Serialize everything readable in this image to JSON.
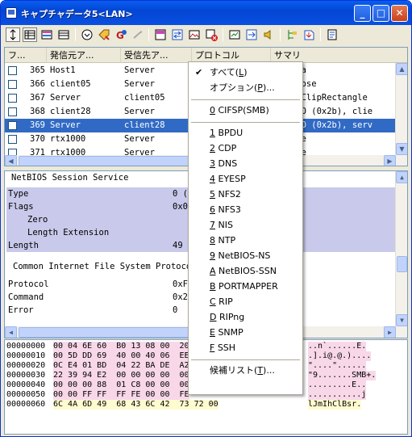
{
  "window": {
    "title": "キャプチャデータ5<LAN>"
  },
  "titlebar": {
    "min": "_",
    "max": "□",
    "close": "✕"
  },
  "toolbar": {
    "icons": [
      "expand-icon",
      "grid-view-icon",
      "color-view-icon",
      "table-view-icon",
      "filter-down-icon",
      "tag-icon",
      "refresh-g-icon",
      "cut-icon",
      "capture-icon",
      "swap-icon",
      "image-icon",
      "delete-icon",
      "export-icon",
      "import-icon",
      "sound-icon",
      "tree-icon",
      "download-icon",
      "notes-icon"
    ]
  },
  "list": {
    "headers": [
      "フ...",
      "発信元ア...",
      "受信先ア...",
      "プロトコル",
      "サマリ"
    ],
    "rows": [
      {
        "no": "365",
        "src": "Host1",
        "dst": "Server",
        "summary": "n Data",
        "selected": false
      },
      {
        "no": "366",
        "src": "client05",
        "dst": "Server",
        "summary": "n Expose",
        "selected": false
      },
      {
        "no": "367",
        "src": "Server",
        "dst": "client05",
        "summary": ": SetClipRectangle",
        "selected": false
      },
      {
        "no": "368",
        "src": "client28",
        "dst": "Server",
        "summary": "M_ECHO (0x2b), clie",
        "selected": false
      },
      {
        "no": "369",
        "src": "Server",
        "dst": "client28",
        "summary": "M_ECHO (0x2b), serv",
        "selected": true
      },
      {
        "no": "370",
        "src": "rtx1000",
        "dst": "Server",
        "summary": "notice",
        "selected": false
      },
      {
        "no": "371",
        "src": "rtx1000",
        "dst": "Server",
        "summary": "notice",
        "selected": false
      }
    ]
  },
  "detail": {
    "section1": "NetBIOS Session Service",
    "lines1": [
      {
        "label": "Type",
        "value": "0 (",
        "indent": 0,
        "band": true
      },
      {
        "label": "Flags",
        "value": "0x0",
        "indent": 0,
        "band": true
      },
      {
        "label": "Zero",
        "value": "",
        "indent": 2,
        "band": true
      },
      {
        "label": "Length Extension",
        "value": "",
        "indent": 2,
        "band": true
      },
      {
        "label": "Length",
        "value": "49",
        "indent": 0,
        "band": true
      }
    ],
    "section2": "Common Internet File System Protocol",
    "lines2": [
      {
        "label": "Protocol",
        "value": "0xF",
        "indent": 0,
        "band": false
      },
      {
        "label": "Command",
        "value": "0x2",
        "indent": 0,
        "band": false
      },
      {
        "label": "Error",
        "value": "0",
        "indent": 0,
        "band": false
      }
    ]
  },
  "hex": {
    "lines": [
      {
        "off": "00000000",
        "bytes": "00 04 6E 60  B0 13 08 00  20",
        "ascii": "..n`......E."
      },
      {
        "off": "00000010",
        "bytes": "00 5D DD 69  40 00 40 06  EE",
        "ascii": ".].i@.@.)...."
      },
      {
        "off": "00000020",
        "bytes": "0C E4 01 BD  04 22 BA DE  A2",
        "ascii": "\"....\"......"
      },
      {
        "off": "00000030",
        "bytes": "22 39 94 E2  00 00 00 00  00",
        "ascii": "\"9.......SMB+."
      },
      {
        "off": "00000040",
        "bytes": "00 00 00 88  01 C8 00 00  00",
        "ascii": ".........E.."
      },
      {
        "off": "00000050",
        "bytes": "00 00 FF FF  FF FE 00 00  FE",
        "ascii": "...........j"
      },
      {
        "off": "00000060",
        "bytes": "6C 4A 6D 49  68 43 6C 42  73 72 00",
        "ascii": "lJmIhClBsr."
      }
    ]
  },
  "menu": {
    "items": [
      {
        "text": "すべて(",
        "key": "L",
        "tail": ")",
        "checked": true
      },
      {
        "text": "オプション(",
        "key": "P",
        "tail": ")...",
        "checked": false
      },
      {
        "sep": true
      },
      {
        "key": "0",
        "text": " CIFSP(SMB)"
      },
      {
        "sep": true
      },
      {
        "key": "1",
        "text": " BPDU"
      },
      {
        "key": "2",
        "text": " CDP"
      },
      {
        "key": "3",
        "text": " DNS"
      },
      {
        "key": "4",
        "text": " EYESP"
      },
      {
        "key": "5",
        "text": " NFS2"
      },
      {
        "key": "6",
        "text": " NFS3"
      },
      {
        "key": "7",
        "text": " NIS"
      },
      {
        "key": "8",
        "text": " NTP"
      },
      {
        "key": "9",
        "text": " NetBIOS-NS"
      },
      {
        "key": "A",
        "text": " NetBIOS-SSN"
      },
      {
        "key": "B",
        "text": " PORTMAPPER"
      },
      {
        "key": "C",
        "text": " RIP"
      },
      {
        "key": "D",
        "text": " RIPng"
      },
      {
        "key": "E",
        "text": " SNMP"
      },
      {
        "key": "F",
        "text": " SSH"
      },
      {
        "sep": true
      },
      {
        "text": "候補リスト(",
        "key": "T",
        "tail": ")..."
      }
    ]
  }
}
